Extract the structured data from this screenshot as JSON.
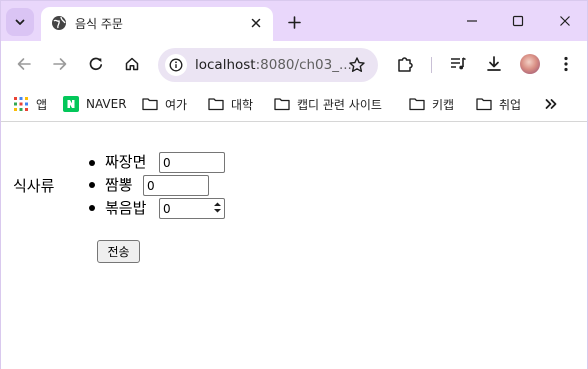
{
  "browser": {
    "tab_title": "음식 주문",
    "url_host": "localhost",
    "url_path": ":8080/ch03_...",
    "theme_color": "#e9d7fb"
  },
  "bookmarks": [
    {
      "label": "앱",
      "icon": "apps-grid-icon"
    },
    {
      "label": "NAVER",
      "icon": "naver-logo-icon"
    },
    {
      "label": "여가",
      "icon": "folder-icon"
    },
    {
      "label": "대학",
      "icon": "folder-icon"
    },
    {
      "label": "캡디 관련 사이트",
      "icon": "folder-icon"
    },
    {
      "label": "키캡",
      "icon": "folder-icon"
    },
    {
      "label": "취업",
      "icon": "folder-icon"
    }
  ],
  "form": {
    "category": "식사류",
    "items": [
      {
        "label": "짜장면",
        "value": "0"
      },
      {
        "label": "짬뽕",
        "value": "0"
      },
      {
        "label": "볶음밥",
        "value": "0"
      }
    ],
    "submit_label": "전송"
  }
}
